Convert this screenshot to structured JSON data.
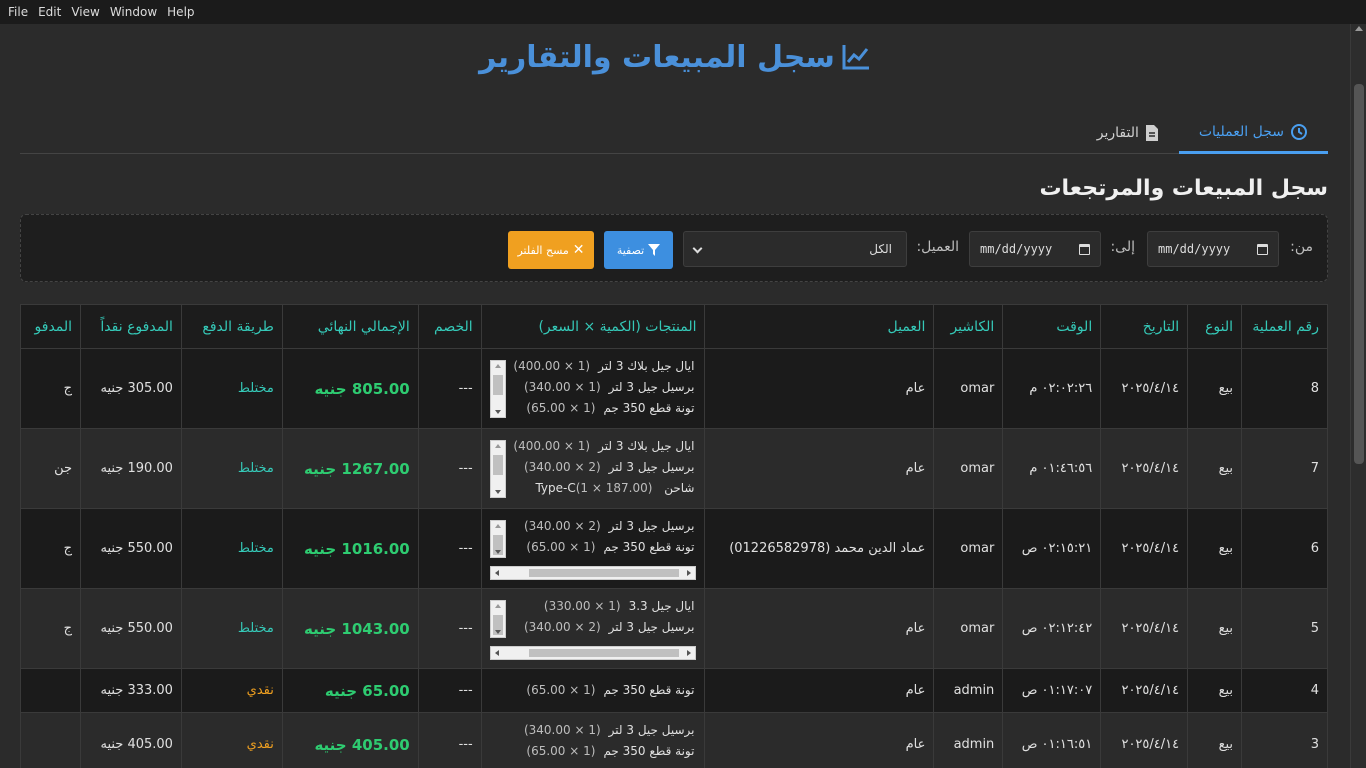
{
  "menu": [
    "File",
    "Edit",
    "View",
    "Window",
    "Help"
  ],
  "page_title": "سجل المبيعات والتقارير",
  "tabs": [
    {
      "label": "سجل العمليات",
      "icon": "history-icon",
      "active": true
    },
    {
      "label": "التقارير",
      "icon": "file-icon",
      "active": false
    }
  ],
  "section_title": "سجل المبيعات والمرتجعات",
  "filters": {
    "from_label": "من:",
    "from_placeholder": "mm/dd/yyyy",
    "to_label": "إلى:",
    "to_placeholder": "mm/dd/yyyy",
    "customer_label": "العميل:",
    "customer_value": "الكل",
    "filter_button": "تصفية",
    "clear_button": "مسح الفلتر"
  },
  "table": {
    "headers": [
      "رقم العملية",
      "النوع",
      "التاريخ",
      "الوقت",
      "الكاشير",
      "العميل",
      "المنتجات (الكمية × السعر)",
      "الخصم",
      "الإجمالي النهائي",
      "طريقة الدفع",
      "المدفوع نقداً",
      "المدفو"
    ],
    "rows": [
      {
        "id": "8",
        "type": "بيع",
        "date": "٢٠٢٥/٤/١٤",
        "time": "٠٢:٠٢:٢٦ م",
        "cashier": "omar",
        "customer": "عام",
        "products": [
          {
            "name": "ايال جيل بلاك 3 لتر",
            "qty": "(1 × 400.00)"
          },
          {
            "name": "برسيل جيل 3 لتر",
            "qty": "(1 × 340.00)"
          },
          {
            "name": "تونة قطع 350 جم",
            "qty": "(1 × 65.00)"
          }
        ],
        "discount": "---",
        "total": "805.00 جنيه",
        "payment": "مختلط",
        "cash_paid": "305.00 جنيه",
        "other": "ج"
      },
      {
        "id": "7",
        "type": "بيع",
        "date": "٢٠٢٥/٤/١٤",
        "time": "٠١:٤٦:٥٦ م",
        "cashier": "omar",
        "customer": "عام",
        "products": [
          {
            "name": "ايال جيل بلاك 3 لتر",
            "qty": "(1 × 400.00)"
          },
          {
            "name": "برسيل جيل 3 لتر",
            "qty": "(2 × 340.00)"
          },
          {
            "name": "شاحن Type-C",
            "qty": "(1 × 187.00)"
          }
        ],
        "discount": "---",
        "total": "1267.00 جنيه",
        "payment": "مختلط",
        "cash_paid": "190.00 جنيه",
        "other": "جن"
      },
      {
        "id": "6",
        "type": "بيع",
        "date": "٢٠٢٥/٤/١٤",
        "time": "٠٢:١٥:٢١ ص",
        "cashier": "omar",
        "customer": "عماد الدين محمد (01226582978)",
        "products": [
          {
            "name": "برسيل جيل 3 لتر",
            "qty": "(2 × 340.00)"
          },
          {
            "name": "تونة قطع 350 جم",
            "qty": "(1 × 65.00)"
          }
        ],
        "discount": "---",
        "total": "1016.00 جنيه",
        "payment": "مختلط",
        "cash_paid": "550.00 جنيه",
        "other": "ج"
      },
      {
        "id": "5",
        "type": "بيع",
        "date": "٢٠٢٥/٤/١٤",
        "time": "٠٢:١٢:٤٢ ص",
        "cashier": "omar",
        "customer": "عام",
        "products": [
          {
            "name": "ايال جيل 3.3",
            "qty": "(1 × 330.00)"
          },
          {
            "name": "برسيل جيل 3 لتر",
            "qty": "(2 × 340.00)"
          }
        ],
        "discount": "---",
        "total": "1043.00 جنيه",
        "payment": "مختلط",
        "cash_paid": "550.00 جنيه",
        "other": "ج"
      },
      {
        "id": "4",
        "type": "بيع",
        "date": "٢٠٢٥/٤/١٤",
        "time": "٠١:١٧:٠٧ ص",
        "cashier": "admin",
        "customer": "عام",
        "products": [
          {
            "name": "تونة قطع 350 جم",
            "qty": "(1 × 65.00)"
          }
        ],
        "discount": "---",
        "total": "65.00 جنيه",
        "payment": "نقدي",
        "cash_paid": "333.00 جنيه",
        "other": ""
      },
      {
        "id": "3",
        "type": "بيع",
        "date": "٢٠٢٥/٤/١٤",
        "time": "٠١:١٦:٥١ ص",
        "cashier": "admin",
        "customer": "عام",
        "products": [
          {
            "name": "برسيل جيل 3 لتر",
            "qty": "(1 × 340.00)"
          },
          {
            "name": "تونة قطع 350 جم",
            "qty": "(1 × 65.00)"
          }
        ],
        "discount": "---",
        "total": "405.00 جنيه",
        "payment": "نقدي",
        "cash_paid": "405.00 جنيه",
        "other": ""
      }
    ]
  }
}
